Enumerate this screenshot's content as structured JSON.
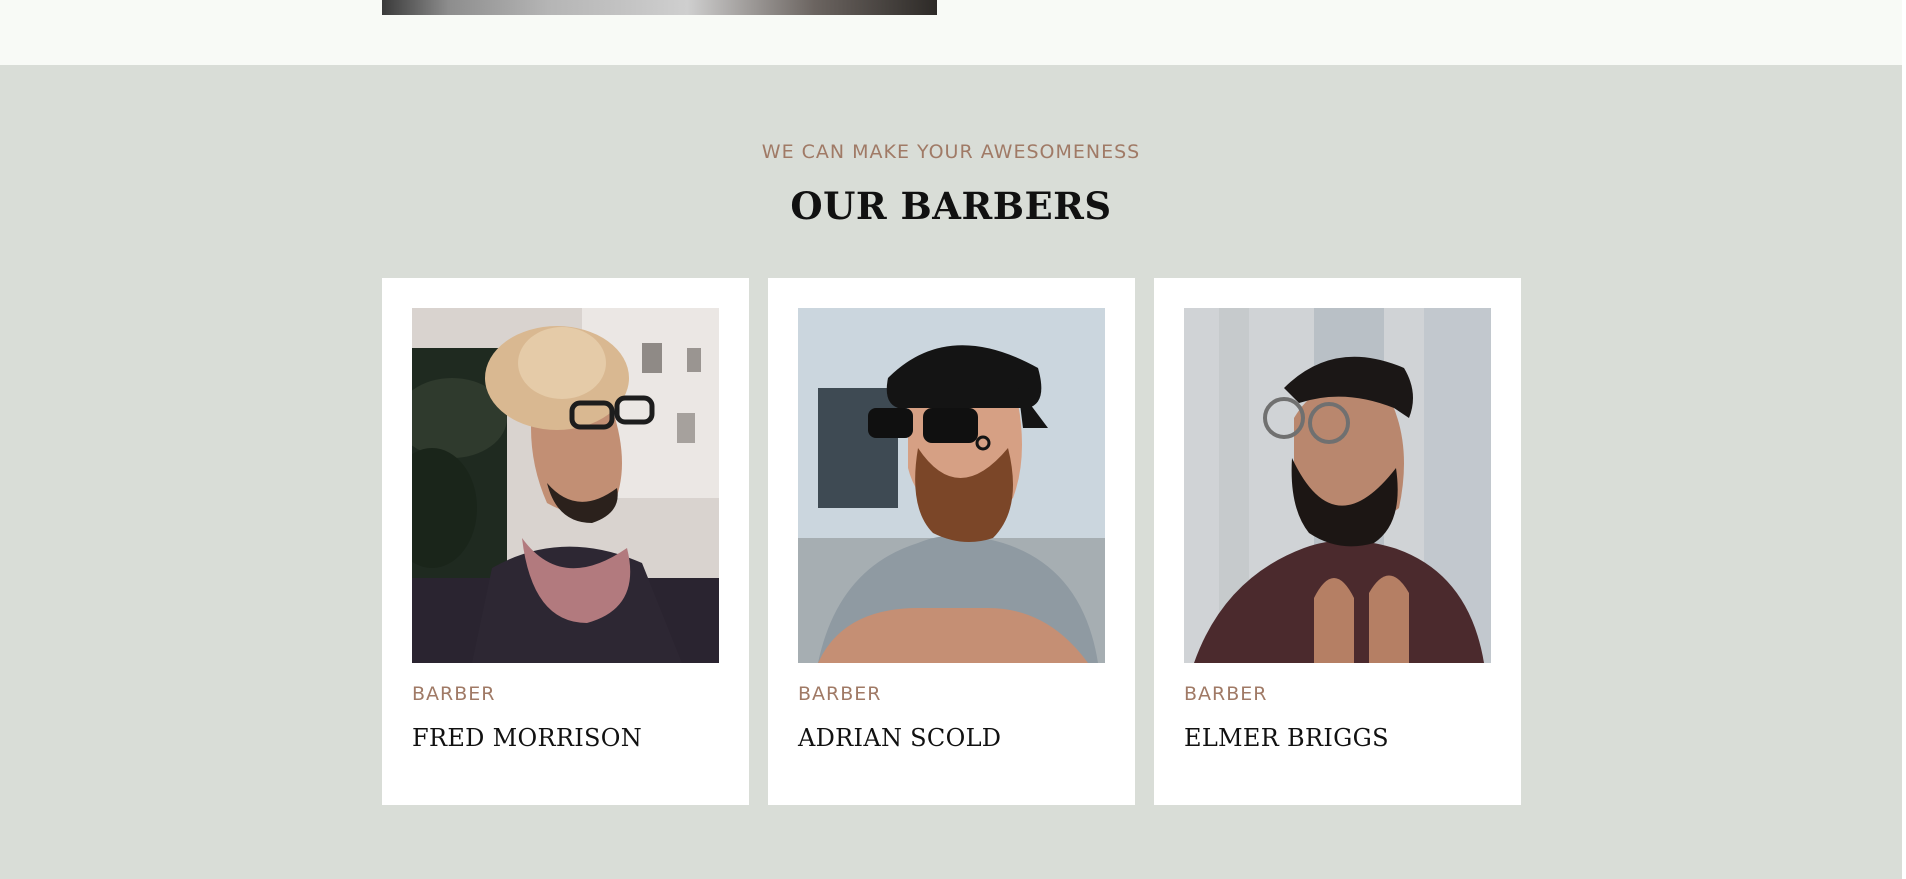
{
  "section": {
    "eyebrow": "WE CAN MAKE YOUR AWESOMENESS",
    "title": "OUR BARBERS"
  },
  "barbers": [
    {
      "role": "BARBER",
      "name": "FRED MORRISON",
      "photo": "barber-photo-fred-morrison"
    },
    {
      "role": "BARBER",
      "name": "ADRIAN SCOLD",
      "photo": "barber-photo-adrian-scold"
    },
    {
      "role": "BARBER",
      "name": "ELMER BRIGGS",
      "photo": "barber-photo-elmer-briggs"
    }
  ],
  "colors": {
    "background": "#d9ddd7",
    "top_band": "#f8faf6",
    "accent": "#a07a66",
    "heading": "#111111",
    "card": "#ffffff"
  }
}
